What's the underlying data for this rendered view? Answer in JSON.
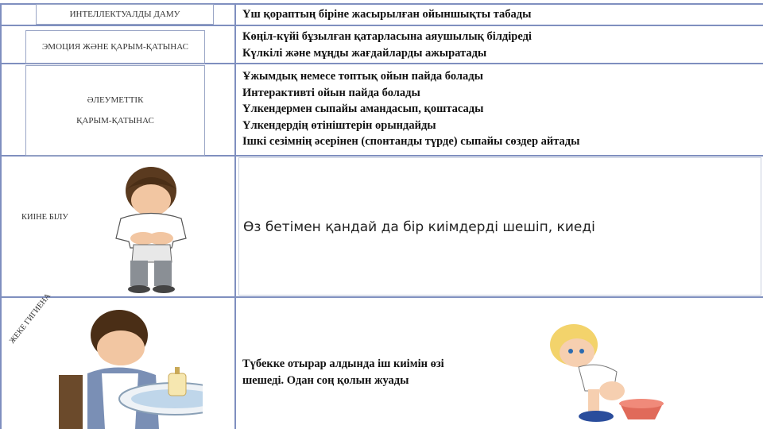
{
  "rows": {
    "intellectual": {
      "label": "ИНТЕЛЛЕКТУАЛДЫ ДАМУ",
      "lines": [
        "Үш қораптың біріне жасырылған ойыншықты табады"
      ]
    },
    "emotion": {
      "label": "ЭМОЦИЯ ЖӘНЕ ҚАРЫМ-ҚАТЫНАС",
      "lines": [
        "Көңіл-күйі бұзылған қатарласына аяушылық білдіреді",
        "Күлкілі және мұңды жағдайларды ажыратады"
      ]
    },
    "social": {
      "label_line1": "ӘЛЕУМЕТТІК",
      "label_line2": "ҚАРЫМ-ҚАТЫНАС",
      "lines": [
        "Ұжымдық немесе топтық ойын пайда болады",
        "Интерактивті ойын пайда болады",
        "Үлкендермен сыпайы амандасып, қоштасады",
        "Үлкендердің өтініштерін орындайды",
        "Ішкі сезімнің әсерінен (спонтанды түрде) сыпайы сөздер айтады"
      ]
    },
    "dressing": {
      "label": "КИІНЕ БІЛУ",
      "text": "Өз бетімен қандай да бір киімдерді шешіп, киеді"
    },
    "hygiene": {
      "label": "ЖЕКЕ ГИГИЕНА",
      "lines": [
        "Түбекке отырар алдында іш киімін өзі",
        "шешеді. Одан соң қолын жуады"
      ]
    }
  },
  "colors": {
    "grid": "#7f8fbf",
    "text": "#111111"
  }
}
